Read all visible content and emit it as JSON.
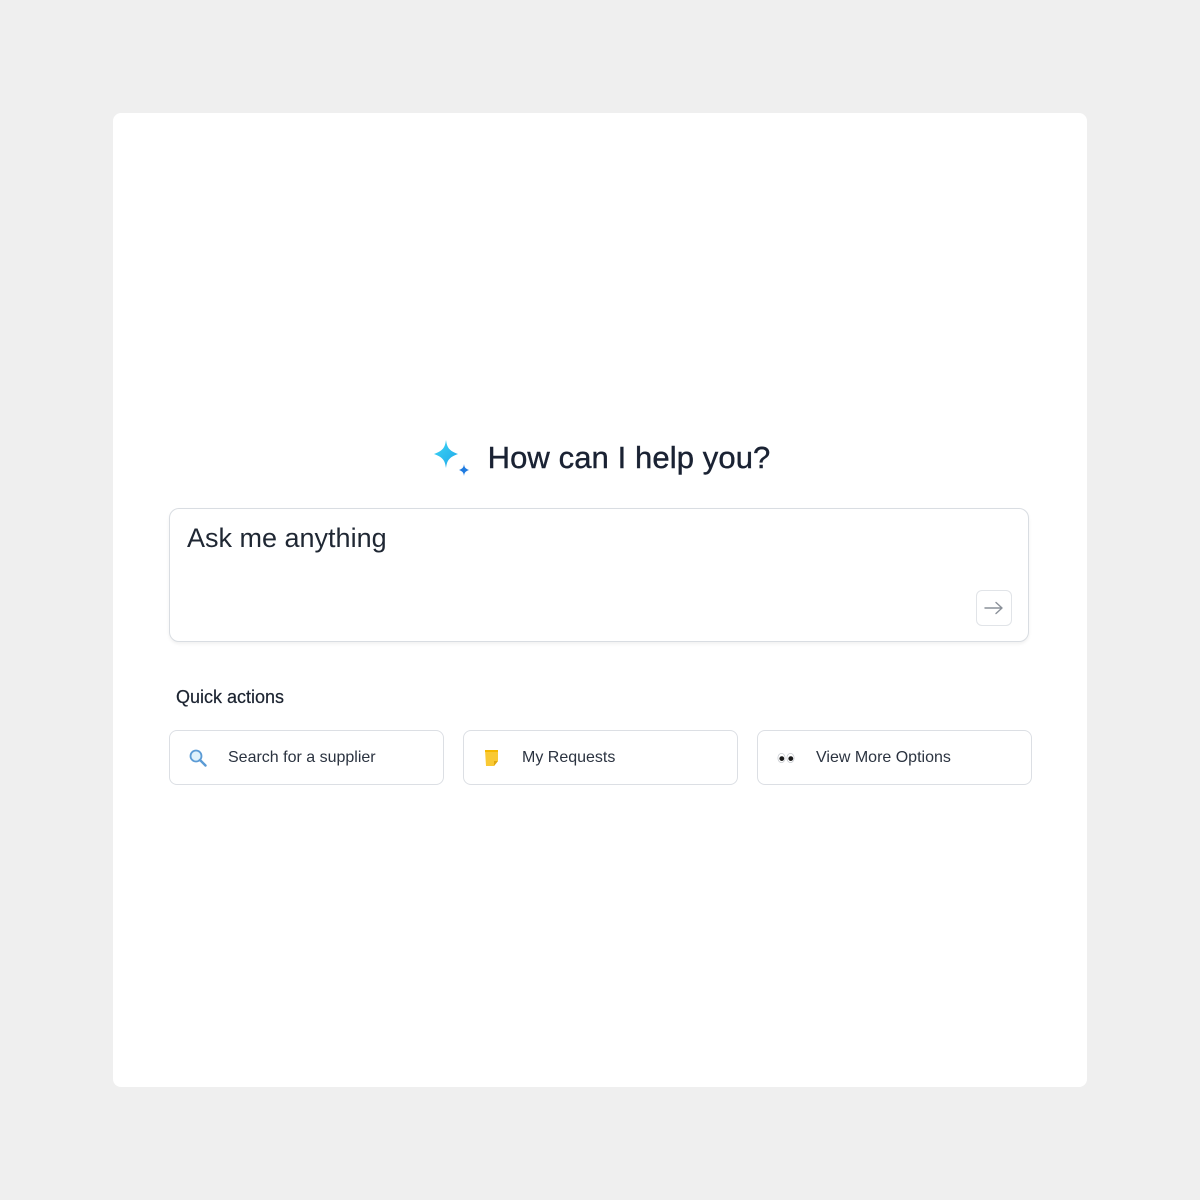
{
  "header": {
    "title": "How can I help you?",
    "icon": "sparkle-icon",
    "icon_colors": [
      "#29c4f0",
      "#1f7be0"
    ]
  },
  "prompt": {
    "placeholder": "Ask me anything",
    "value": "",
    "send_icon": "arrow-right-icon"
  },
  "quick_actions": {
    "title": "Quick actions",
    "items": [
      {
        "label": "Search for a supplier",
        "icon": "magnifier-icon"
      },
      {
        "label": "My Requests",
        "icon": "note-icon"
      },
      {
        "label": "View More Options",
        "icon": "eyes-icon"
      }
    ]
  }
}
